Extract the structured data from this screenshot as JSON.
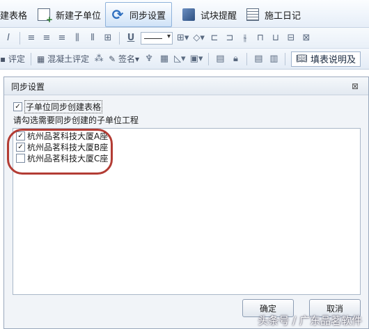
{
  "ribbon": {
    "tabs": [
      {
        "label": "建表格",
        "icon": "table-icon"
      },
      {
        "label": "新建子单位",
        "icon": "new-subunit-icon"
      },
      {
        "label": "同步设置",
        "icon": "sync-icon",
        "active": true
      },
      {
        "label": "试块提醒",
        "icon": "test-block-icon"
      },
      {
        "label": "施工日记",
        "icon": "diary-icon"
      }
    ]
  },
  "toolbar": {
    "row2": {
      "review_label": "评定",
      "concrete_label": "混凝土评定",
      "sign_label": "签名",
      "fill_help_label": "填表说明及"
    }
  },
  "dialog": {
    "title": "同步设置",
    "create_table_checkbox": {
      "label": "子单位同步创建表格",
      "checked": true
    },
    "instruction": "请勾选需要同步创建的子单位工程",
    "items": [
      {
        "label": "杭州品茗科技大厦A座",
        "checked": true
      },
      {
        "label": "杭州品茗科技大厦B座",
        "checked": true
      },
      {
        "label": "杭州品茗科技大厦C座",
        "checked": false
      }
    ],
    "ok_label": "确定",
    "cancel_label": "取消"
  },
  "watermark": "头条号 / 广东品茗软件",
  "colors": {
    "highlight": "#b33c34",
    "ribbon_active": "#cfe2f7",
    "dialog_bg": "#f1f4f8"
  }
}
